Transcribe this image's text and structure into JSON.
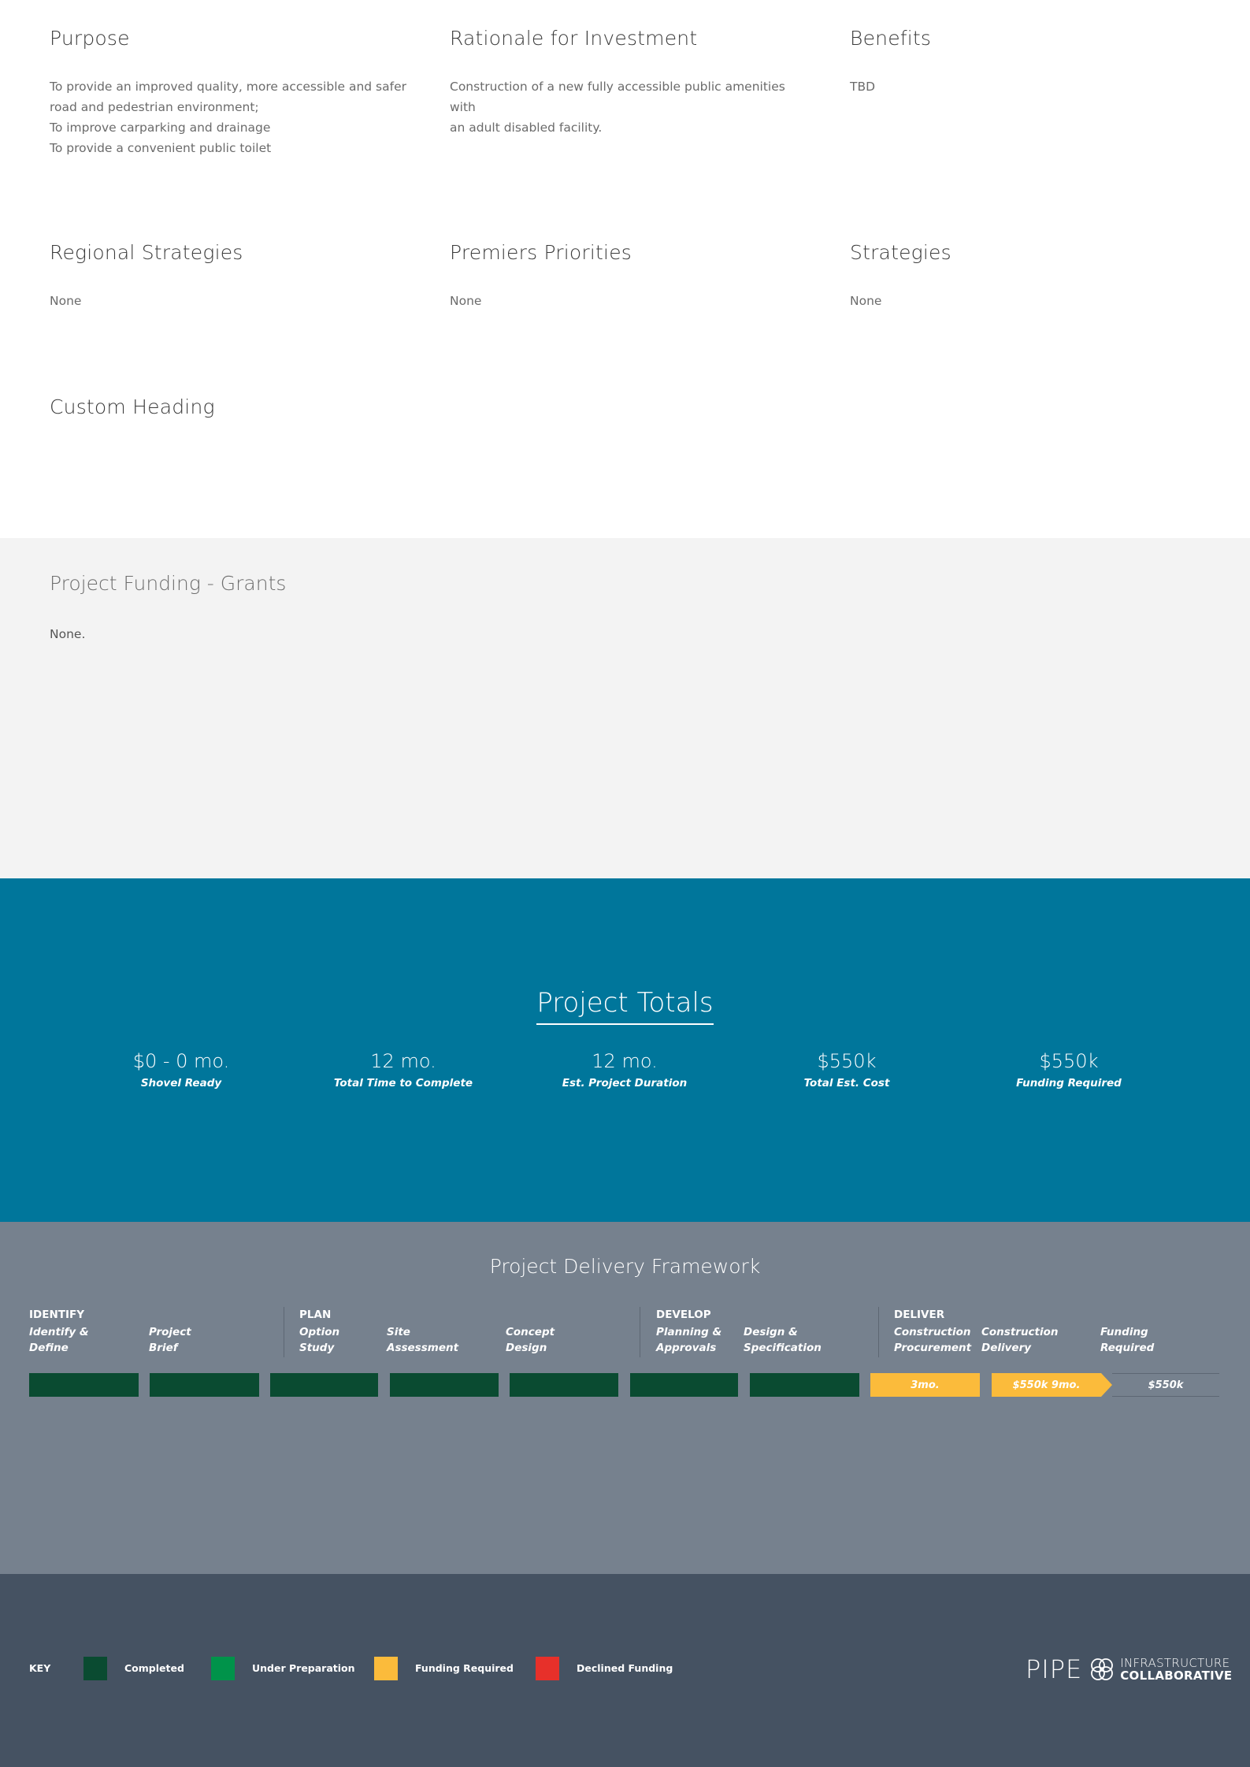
{
  "sections": {
    "purpose": {
      "heading": "Purpose",
      "lines": [
        "To provide an improved quality, more accessible and safer",
        "road and pedestrian environment;",
        "To improve carparking and drainage",
        "To provide a convenient public toilet"
      ]
    },
    "rationale": {
      "heading": "Rationale for Investment",
      "lines": [
        "Construction of a new fully accessible public amenities with",
        "an adult disabled facility."
      ]
    },
    "benefits": {
      "heading": "Benefits",
      "text": "TBD"
    },
    "regional": {
      "heading": "Regional Strategies",
      "text": "None"
    },
    "premiers": {
      "heading": "Premiers Priorities",
      "text": "None"
    },
    "strategies": {
      "heading": "Strategies",
      "text": "None"
    },
    "custom": {
      "heading": "Custom Heading"
    }
  },
  "grants": {
    "heading": "Project Funding - Grants",
    "text": "None."
  },
  "totals": {
    "heading": "Project Totals",
    "stats": [
      {
        "value": "$0 - 0 mo.",
        "label": "Shovel Ready"
      },
      {
        "value": "12 mo.",
        "label": "Total Time to Complete"
      },
      {
        "value": "12 mo.",
        "label": "Est. Project Duration"
      },
      {
        "value": "$550k",
        "label": "Total Est. Cost"
      },
      {
        "value": "$550k",
        "label": "Funding Required"
      }
    ]
  },
  "framework": {
    "heading": "Project Delivery Framework",
    "phases": [
      "IDENTIFY",
      "PLAN",
      "DEVELOP",
      "DELIVER"
    ],
    "steps": [
      {
        "line1": "Identify &",
        "line2": "Define",
        "status": "completed"
      },
      {
        "line1": "Project",
        "line2": "Brief",
        "status": "completed"
      },
      {
        "line1": "Option",
        "line2": "Study",
        "status": "completed"
      },
      {
        "line1": "Site",
        "line2": "Assessment",
        "status": "completed"
      },
      {
        "line1": "Concept",
        "line2": "Design",
        "status": "completed"
      },
      {
        "line1": "Planning &",
        "line2": "Approvals",
        "status": "completed"
      },
      {
        "line1": "Design &",
        "line2": "Specification",
        "status": "completed"
      },
      {
        "line1": "Construction",
        "line2": "Procurement",
        "status": "funding-required",
        "bar_text": "3mo."
      },
      {
        "line1": "Construction",
        "line2": "Delivery",
        "status": "funding-required",
        "bar_text": "$550k 9mo."
      },
      {
        "line1": "Funding",
        "line2": "Required",
        "status": "outline",
        "bar_text": "$550k"
      }
    ]
  },
  "key": {
    "label": "KEY",
    "items": [
      {
        "text": "Completed",
        "color": "#0a4b31"
      },
      {
        "text": "Under Preparation",
        "color": "#00934a"
      },
      {
        "text": "Funding Required",
        "color": "#fbbb3b"
      },
      {
        "text": "Declined Funding",
        "color": "#e7302a"
      }
    ]
  },
  "logo": {
    "name": "PIPE",
    "line1": "INFRASTRUCTURE",
    "line2": "COLLABORATIVE"
  }
}
